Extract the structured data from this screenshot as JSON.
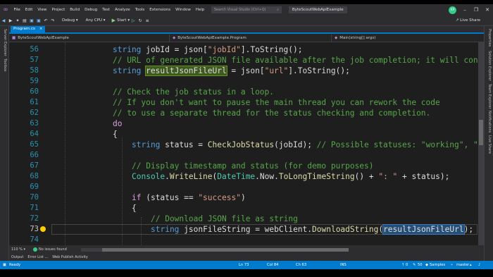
{
  "titlebar": {
    "menu": [
      "File",
      "Edit",
      "View",
      "Project",
      "Build",
      "Debug",
      "Test",
      "Analyze",
      "Tools",
      "Extensions",
      "Window",
      "Help"
    ],
    "search_placeholder": "Search Visual Studio (Ctrl+Q)",
    "solution_name": "ByteScoutWebApiExample",
    "user_initials": "KP",
    "live_share": "Live Share"
  },
  "toolbar": {
    "configuration": "Debug",
    "platform": "Any CPU",
    "start_label": "Start"
  },
  "left_strip": [
    "Server Explorer",
    "Toolbox"
  ],
  "right_strip": [
    "Properties",
    "Solution Explorer",
    "Team Explorer",
    "Notifications",
    "Live Share"
  ],
  "doc_tab": {
    "name": "Program.cs",
    "close": "×"
  },
  "navbar": {
    "project": "ByteScoutWebApiExample",
    "class": "ByteScoutWebApiExample.Program",
    "member": "Main(string[] args)"
  },
  "editor": {
    "lines": [
      {
        "n": "56"
      },
      {
        "n": "57"
      },
      {
        "n": "58"
      },
      {
        "n": "59"
      },
      {
        "n": "60"
      },
      {
        "n": "61"
      },
      {
        "n": "62"
      },
      {
        "n": "63"
      },
      {
        "n": "64"
      },
      {
        "n": "65"
      },
      {
        "n": "66"
      },
      {
        "n": "67"
      },
      {
        "n": "68"
      },
      {
        "n": "69"
      },
      {
        "n": "70"
      },
      {
        "n": "71"
      },
      {
        "n": "72"
      },
      {
        "n": "73"
      },
      {
        "n": "74"
      }
    ],
    "current_line": "73",
    "code": {
      "l56": [
        "string",
        " jobId = json[",
        "\"jobId\"",
        "].ToString();"
      ],
      "l57": "// URL of generated JSON file available after the job completion; it will cont",
      "l58": [
        "string",
        " ",
        "resultJsonFileUrl",
        " = json[",
        "\"url\"",
        "].ToString();"
      ],
      "l60": "// Check the job status in a loop.",
      "l61": "// If you don't want to pause the main thread you can rework the code",
      "l62": "// to use a separate thread for the status checking and completion.",
      "l63": "do",
      "l64": "{",
      "l65": [
        "string",
        " status = ",
        "CheckJobStatus",
        "(jobId); ",
        "// Possible statuses: \"working\", \"f"
      ],
      "l67": "// Display timestamp and status (for demo purposes)",
      "l68": [
        "Console",
        ".",
        "WriteLine",
        "(",
        "DateTime",
        ".Now.",
        "ToLongTimeString",
        "() + ",
        "\": \"",
        " + status);"
      ],
      "l70": [
        "if",
        " (status == ",
        "\"success\"",
        ")"
      ],
      "l71": "{",
      "l72": "// Download JSON file as string",
      "l73": [
        "string",
        " jsonFileString = webClient.",
        "DownloadString",
        "(",
        "resultJsonFileUrl",
        ");"
      ]
    }
  },
  "bottom": {
    "zoom": "110 %",
    "issues": "No issues found"
  },
  "tool_windows": [
    "Output",
    "Error List ...",
    "Web Publish Activity"
  ],
  "statusbar": {
    "ready": "Ready",
    "ln": "Ln 73",
    "col": "Col 84",
    "ch": "Ch 63",
    "ins": "INS",
    "up": "0",
    "pencil": "50",
    "repo": "Samples",
    "branch": "master"
  },
  "colors": {
    "accent": "#007acc",
    "keyword": "#569cd6",
    "string": "#d69d85",
    "comment": "#57a64a",
    "method": "#dcdcaa",
    "type": "#4ec9b0"
  }
}
